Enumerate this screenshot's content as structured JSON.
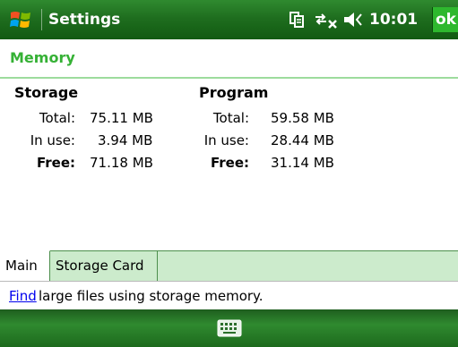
{
  "titlebar": {
    "title": "Settings",
    "time": "10:01",
    "ok_label": "ok"
  },
  "section": {
    "title": "Memory"
  },
  "storage": {
    "title": "Storage",
    "rows": [
      {
        "label": "Total:",
        "value": "75.11 MB"
      },
      {
        "label": "In use:",
        "value": "3.94 MB"
      },
      {
        "label": "Free:",
        "value": "71.18 MB"
      }
    ]
  },
  "program": {
    "title": "Program",
    "rows": [
      {
        "label": "Total:",
        "value": "59.58 MB"
      },
      {
        "label": "In use:",
        "value": "28.44 MB"
      },
      {
        "label": "Free:",
        "value": "31.14 MB"
      }
    ]
  },
  "tabs": [
    {
      "label": "Main",
      "active": true
    },
    {
      "label": "Storage Card",
      "active": false
    }
  ],
  "find": {
    "link": "Find",
    "text": "large files using storage memory."
  },
  "colors": {
    "titlebar": "#1f6e1f",
    "accent": "#35b135",
    "tabbar": "#ccebcc",
    "link": "#0000ee"
  },
  "icons": {
    "start": "windows-flag-icon",
    "tray": [
      "sync-icon",
      "connectivity-icon",
      "volume-icon"
    ],
    "bottom": "keyboard-icon"
  }
}
